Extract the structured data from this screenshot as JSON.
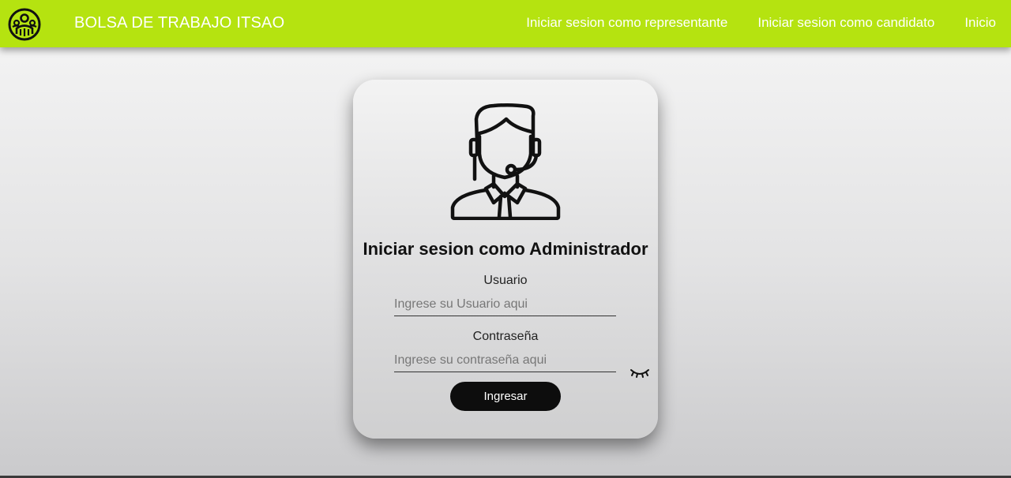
{
  "navbar": {
    "logo_icon": "people-group-icon",
    "brand": "BOLSA DE TRABAJO ITSAO",
    "links": [
      "Iniciar sesion como representante",
      "Iniciar sesion como candidato",
      "Inicio"
    ],
    "color": "#b5e310"
  },
  "login": {
    "avatar_icon": "support-agent-icon",
    "title": "Iniciar sesion como Administrador",
    "user_label": "Usuario",
    "user_placeholder": "Ingrese su Usuario aqui",
    "user_value": "",
    "pass_label": "Contraseña",
    "pass_placeholder": "Ingrese su contraseña aqui",
    "pass_value": "",
    "toggle_icon": "eye-closed-icon",
    "submit_label": "Ingresar"
  }
}
